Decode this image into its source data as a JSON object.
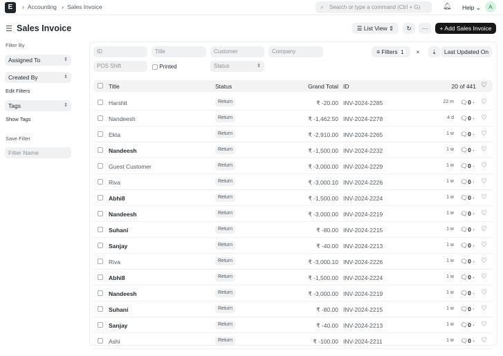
{
  "topbar": {
    "logo": "E",
    "breadcrumbs": [
      "Accounting",
      "Sales Invoice"
    ],
    "search_placeholder": "Search or type a command (Ctrl + G)",
    "help": "Help",
    "avatar": "A"
  },
  "page": {
    "title": "Sales Invoice",
    "list_view": "List View",
    "add_button": "+ Add Sales Invoice",
    "more": "···"
  },
  "sidebar": {
    "filter_by": "Filter By",
    "assigned_to": "Assigned To",
    "created_by": "Created By",
    "edit_filters": "Edit Filters",
    "tags": "Tags",
    "show_tags": "Show Tags",
    "save_filter": "Save Filter",
    "filter_name_placeholder": "Filter Name"
  },
  "filters": {
    "id": "ID",
    "title": "Title",
    "customer": "Customer",
    "company": "Company",
    "pos_shift": "POS Shift",
    "printed": "Printed",
    "status": "Status",
    "filters_label": "Filters",
    "filters_count": "1",
    "sort": "Last Updated On"
  },
  "table": {
    "headers": {
      "title": "Title",
      "status": "Status",
      "grand_total": "Grand Total",
      "id": "ID",
      "count": "20 of 441"
    },
    "rows": [
      {
        "title": "Harshit",
        "bold": false,
        "status": "Return",
        "total": "₹ -20.00",
        "id": "INV-2024-2285",
        "age": "22 m",
        "comments": "0"
      },
      {
        "title": "Nandeesh",
        "bold": false,
        "status": "Return",
        "total": "₹ -1,462.50",
        "id": "INV-2024-2278",
        "age": "4 d",
        "comments": "0"
      },
      {
        "title": "Ekta",
        "bold": false,
        "status": "Return",
        "total": "₹ -2,910.00",
        "id": "INV-2024-2265",
        "age": "1 w",
        "comments": "0"
      },
      {
        "title": "Nandeesh",
        "bold": true,
        "status": "Return",
        "total": "₹ -1,500.00",
        "id": "INV-2024-2232",
        "age": "1 w",
        "comments": "0"
      },
      {
        "title": "Guest Customer",
        "bold": false,
        "status": "Return",
        "total": "₹ -3,000.00",
        "id": "INV-2024-2229",
        "age": "1 w",
        "comments": "0"
      },
      {
        "title": "Riva",
        "bold": false,
        "status": "Return",
        "total": "₹ -3,000.10",
        "id": "INV-2024-2226",
        "age": "1 w",
        "comments": "0"
      },
      {
        "title": "Abhi8",
        "bold": true,
        "status": "Return",
        "total": "₹ -1,500.00",
        "id": "INV-2024-2224",
        "age": "1 w",
        "comments": "0"
      },
      {
        "title": "Nandeesh",
        "bold": true,
        "status": "Return",
        "total": "₹ -3,000.00",
        "id": "INV-2024-2219",
        "age": "1 w",
        "comments": "0"
      },
      {
        "title": "Suhani",
        "bold": true,
        "status": "Return",
        "total": "₹ -80.00",
        "id": "INV-2024-2215",
        "age": "1 w",
        "comments": "0"
      },
      {
        "title": "Sanjay",
        "bold": true,
        "status": "Return",
        "total": "₹ -40.00",
        "id": "INV-2024-2213",
        "age": "1 w",
        "comments": "0"
      },
      {
        "title": "Riva",
        "bold": false,
        "status": "Return",
        "total": "₹ -3,000.10",
        "id": "INV-2024-2226",
        "age": "1 w",
        "comments": "0"
      },
      {
        "title": "Abhi8",
        "bold": true,
        "status": "Return",
        "total": "₹ -1,500.00",
        "id": "INV-2024-2224",
        "age": "1 w",
        "comments": "0"
      },
      {
        "title": "Nandeesh",
        "bold": true,
        "status": "Return",
        "total": "₹ -3,000.00",
        "id": "INV-2024-2219",
        "age": "1 w",
        "comments": "0"
      },
      {
        "title": "Suhani",
        "bold": true,
        "status": "Return",
        "total": "₹ -80.00",
        "id": "INV-2024-2215",
        "age": "1 w",
        "comments": "0"
      },
      {
        "title": "Sanjay",
        "bold": true,
        "status": "Return",
        "total": "₹ -40.00",
        "id": "INV-2024-2213",
        "age": "1 w",
        "comments": "0"
      },
      {
        "title": "Ashi",
        "bold": false,
        "status": "Return",
        "total": "₹ -100.00",
        "id": "INV-2024-2211",
        "age": "1 w",
        "comments": "0"
      }
    ]
  }
}
